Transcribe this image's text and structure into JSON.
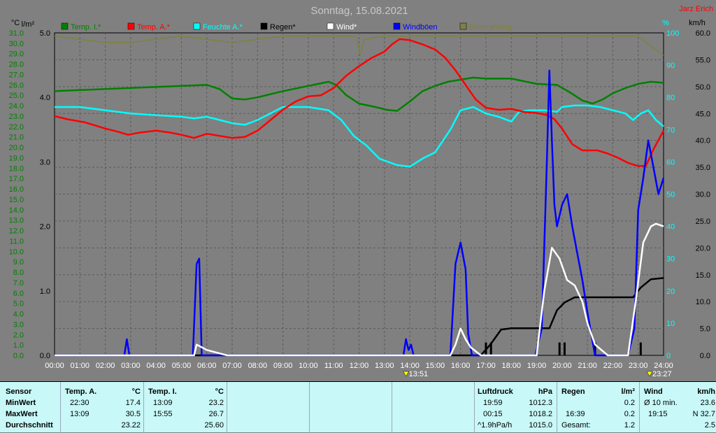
{
  "header": {
    "title": "Sonntag, 15.08.2021",
    "author": "Jarz Erich"
  },
  "colors": {
    "temp_i": "#008000",
    "temp_a": "#ff0000",
    "feuchte": "#00ffff",
    "regen": "#000000",
    "wind": "#ffffff",
    "windboeen": "#0000ff",
    "einstrahlung": "#808040"
  },
  "legend": [
    {
      "label": "Temp. I.*",
      "color": "#008000"
    },
    {
      "label": "Temp. A.*",
      "color": "#ff0000"
    },
    {
      "label": "Feuchte A.*",
      "color": "#00ffff"
    },
    {
      "label": "Regen*",
      "color": "#000000"
    },
    {
      "label": "Wind*",
      "color": "#ffffff"
    },
    {
      "label": "Windböen",
      "color": "#0000ff"
    },
    {
      "label": "Einstrahlung",
      "color": "#808040"
    }
  ],
  "axes": {
    "left_temp_unit": "°C",
    "left_rain_unit": "l/m²",
    "right_hum_unit": "%",
    "right_wind_unit": "km/h",
    "temp_ticks": [
      "31.0",
      "30.0",
      "29.0",
      "28.0",
      "27.0",
      "26.0",
      "25.0",
      "24.0",
      "23.0",
      "22.0",
      "21.0",
      "20.0",
      "19.0",
      "18.0",
      "17.0",
      "16.0",
      "15.0",
      "14.0",
      "13.0",
      "12.0",
      "11.0",
      "10.0",
      "9.0",
      "8.0",
      "7.0",
      "6.0",
      "5.0",
      "4.0",
      "3.0",
      "2.0",
      "1.0",
      "0.0"
    ],
    "rain_ticks": [
      "5.0",
      "4.0",
      "3.0",
      "2.0",
      "1.0",
      "0.0"
    ],
    "hum_ticks": [
      "100",
      "90",
      "80",
      "70",
      "60",
      "50",
      "40",
      "30",
      "20",
      "10",
      "0"
    ],
    "wind_ticks": [
      "60.0",
      "55.0",
      "50.0",
      "45.0",
      "40.0",
      "35.0",
      "30.0",
      "25.0",
      "20.0",
      "15.0",
      "10.0",
      "5.0",
      "0.0"
    ],
    "x_ticks": [
      "00:00",
      "01:00",
      "02:00",
      "03:00",
      "04:00",
      "05:00",
      "06:00",
      "07:00",
      "08:00",
      "09:00",
      "10:00",
      "11:00",
      "12:00",
      "13:00",
      "14:00",
      "15:00",
      "16:00",
      "17:00",
      "18:00",
      "19:00",
      "20:00",
      "21:00",
      "22:00",
      "23:00",
      "24:00"
    ],
    "markers": [
      {
        "time": 13.85,
        "label": "13:51"
      },
      {
        "time": 23.45,
        "label": "23:27"
      }
    ]
  },
  "chart_data": {
    "type": "line",
    "x_unit": "hours",
    "xlim": [
      0,
      24
    ],
    "series": [
      {
        "name": "Temp. I.*",
        "axis": "temp_c",
        "ylim": [
          0,
          31
        ],
        "points": [
          [
            0,
            25.4
          ],
          [
            1,
            25.5
          ],
          [
            2,
            25.6
          ],
          [
            3,
            25.7
          ],
          [
            4,
            25.8
          ],
          [
            5,
            25.9
          ],
          [
            6,
            26.0
          ],
          [
            6.5,
            25.6
          ],
          [
            7,
            24.7
          ],
          [
            7.5,
            24.6
          ],
          [
            8,
            24.8
          ],
          [
            8.5,
            25.1
          ],
          [
            9,
            25.4
          ],
          [
            10,
            25.9
          ],
          [
            10.8,
            26.3
          ],
          [
            11.1,
            26.0
          ],
          [
            11.5,
            25.0
          ],
          [
            12,
            24.2
          ],
          [
            12.6,
            23.9
          ],
          [
            13.1,
            23.6
          ],
          [
            13.5,
            23.5
          ],
          [
            14,
            24.4
          ],
          [
            14.5,
            25.4
          ],
          [
            15,
            25.9
          ],
          [
            15.5,
            26.3
          ],
          [
            16,
            26.5
          ],
          [
            16.5,
            26.7
          ],
          [
            17,
            26.6
          ],
          [
            18,
            26.6
          ],
          [
            19,
            26.1
          ],
          [
            19.8,
            26.0
          ],
          [
            20.3,
            25.3
          ],
          [
            20.8,
            24.5
          ],
          [
            21.2,
            24.2
          ],
          [
            21.6,
            24.6
          ],
          [
            22,
            25.2
          ],
          [
            22.5,
            25.7
          ],
          [
            23,
            26.1
          ],
          [
            23.5,
            26.3
          ],
          [
            24,
            26.2
          ]
        ]
      },
      {
        "name": "Temp. A.*",
        "axis": "temp_c",
        "ylim": [
          0,
          31
        ],
        "points": [
          [
            0,
            23.0
          ],
          [
            0.5,
            22.7
          ],
          [
            1.2,
            22.4
          ],
          [
            2,
            21.8
          ],
          [
            2.5,
            21.5
          ],
          [
            2.9,
            21.2
          ],
          [
            3.3,
            21.4
          ],
          [
            4,
            21.6
          ],
          [
            4.6,
            21.4
          ],
          [
            5,
            21.2
          ],
          [
            5.5,
            20.9
          ],
          [
            6,
            21.3
          ],
          [
            6.5,
            21.1
          ],
          [
            7,
            20.9
          ],
          [
            7.5,
            21.0
          ],
          [
            8,
            21.6
          ],
          [
            8.5,
            22.6
          ],
          [
            9,
            23.6
          ],
          [
            9.5,
            24.4
          ],
          [
            10,
            24.9
          ],
          [
            10.5,
            25.0
          ],
          [
            11,
            25.7
          ],
          [
            11.5,
            26.9
          ],
          [
            12,
            27.8
          ],
          [
            12.5,
            28.6
          ],
          [
            13,
            29.2
          ],
          [
            13.3,
            29.9
          ],
          [
            13.6,
            30.4
          ],
          [
            14,
            30.3
          ],
          [
            14.5,
            29.9
          ],
          [
            15,
            29.4
          ],
          [
            15.4,
            28.6
          ],
          [
            15.8,
            27.4
          ],
          [
            16.2,
            26.0
          ],
          [
            16.6,
            24.6
          ],
          [
            17,
            23.8
          ],
          [
            17.5,
            23.6
          ],
          [
            18,
            23.7
          ],
          [
            18.5,
            23.4
          ],
          [
            19,
            23.3
          ],
          [
            19.4,
            23.1
          ],
          [
            19.7,
            22.7
          ],
          [
            20,
            21.8
          ],
          [
            20.4,
            20.3
          ],
          [
            20.8,
            19.7
          ],
          [
            21.4,
            19.7
          ],
          [
            21.8,
            19.4
          ],
          [
            22.2,
            19.0
          ],
          [
            22.6,
            18.5
          ],
          [
            23,
            18.2
          ],
          [
            23.3,
            18.2
          ],
          [
            23.6,
            19.8
          ],
          [
            24,
            21.6
          ]
        ]
      },
      {
        "name": "Feuchte A.*",
        "axis": "humidity_pct",
        "ylim": [
          0,
          100
        ],
        "points": [
          [
            0,
            77
          ],
          [
            1,
            77
          ],
          [
            2,
            76
          ],
          [
            3,
            75
          ],
          [
            4,
            74.5
          ],
          [
            5,
            74
          ],
          [
            5.5,
            73.5
          ],
          [
            6,
            74
          ],
          [
            6.5,
            73
          ],
          [
            7,
            72
          ],
          [
            7.5,
            71.5
          ],
          [
            8,
            73
          ],
          [
            8.5,
            75
          ],
          [
            9,
            77
          ],
          [
            10,
            77
          ],
          [
            10.8,
            76
          ],
          [
            11.3,
            73
          ],
          [
            11.8,
            68
          ],
          [
            12.3,
            65
          ],
          [
            12.8,
            61
          ],
          [
            13.5,
            59
          ],
          [
            14,
            58.5
          ],
          [
            14.5,
            61
          ],
          [
            15,
            63
          ],
          [
            15.6,
            70
          ],
          [
            16,
            76
          ],
          [
            16.5,
            77
          ],
          [
            17,
            75
          ],
          [
            17.5,
            74
          ],
          [
            18,
            72.5
          ],
          [
            18.3,
            75.5
          ],
          [
            18.7,
            76
          ],
          [
            19.3,
            76
          ],
          [
            19.8,
            75.5
          ],
          [
            20,
            77
          ],
          [
            20.5,
            77.5
          ],
          [
            21,
            77.5
          ],
          [
            21.5,
            77
          ],
          [
            22,
            76
          ],
          [
            22.5,
            75
          ],
          [
            22.8,
            73
          ],
          [
            23.1,
            75
          ],
          [
            23.4,
            76
          ],
          [
            23.7,
            73
          ],
          [
            24,
            71
          ]
        ]
      },
      {
        "name": "Regen*",
        "axis": "rain_lm2",
        "ylim": [
          0,
          5
        ],
        "points": [
          [
            0,
            0
          ],
          [
            16.8,
            0
          ],
          [
            17.2,
            0.18
          ],
          [
            17.6,
            0.4
          ],
          [
            18,
            0.42
          ],
          [
            18.5,
            0.42
          ],
          [
            19,
            0.42
          ],
          [
            19.5,
            0.42
          ],
          [
            19.8,
            0.7
          ],
          [
            20.1,
            0.82
          ],
          [
            20.5,
            0.9
          ],
          [
            21,
            0.9
          ],
          [
            21.8,
            0.9
          ],
          [
            22.3,
            0.9
          ],
          [
            22.8,
            0.9
          ],
          [
            23.1,
            1.05
          ],
          [
            23.5,
            1.18
          ],
          [
            24,
            1.2
          ]
        ]
      },
      {
        "name": "Wind*",
        "axis": "wind_kmh",
        "ylim": [
          0,
          60
        ],
        "points": [
          [
            0,
            0
          ],
          [
            5.5,
            0
          ],
          [
            5.6,
            2
          ],
          [
            6,
            1
          ],
          [
            6.4,
            0.5
          ],
          [
            6.8,
            0
          ],
          [
            15.6,
            0
          ],
          [
            15.8,
            2
          ],
          [
            16,
            5
          ],
          [
            16.2,
            3
          ],
          [
            16.4,
            1.5
          ],
          [
            16.8,
            0
          ],
          [
            19,
            0
          ],
          [
            19.3,
            12
          ],
          [
            19.6,
            20
          ],
          [
            19.9,
            18
          ],
          [
            20.2,
            14
          ],
          [
            20.5,
            13
          ],
          [
            20.8,
            10
          ],
          [
            21,
            6
          ],
          [
            21.3,
            2
          ],
          [
            21.8,
            0
          ],
          [
            22.6,
            0
          ],
          [
            22.9,
            10
          ],
          [
            23.2,
            21
          ],
          [
            23.5,
            24
          ],
          [
            23.7,
            24.5
          ],
          [
            24,
            24
          ]
        ]
      },
      {
        "name": "Windböen",
        "axis": "wind_kmh",
        "ylim": [
          0,
          60
        ],
        "points": [
          [
            0,
            0
          ],
          [
            2.75,
            0
          ],
          [
            2.85,
            3
          ],
          [
            2.95,
            0
          ],
          [
            5.45,
            0
          ],
          [
            5.6,
            17
          ],
          [
            5.7,
            18
          ],
          [
            5.8,
            0
          ],
          [
            13.75,
            0
          ],
          [
            13.85,
            3
          ],
          [
            13.95,
            1
          ],
          [
            14.05,
            2
          ],
          [
            14.15,
            0
          ],
          [
            15.6,
            0
          ],
          [
            15.8,
            17
          ],
          [
            16,
            21
          ],
          [
            16.2,
            16
          ],
          [
            16.3,
            4
          ],
          [
            16.45,
            0
          ],
          [
            18.95,
            0
          ],
          [
            19.2,
            5
          ],
          [
            19.4,
            36
          ],
          [
            19.5,
            53
          ],
          [
            19.6,
            40
          ],
          [
            19.7,
            28
          ],
          [
            19.8,
            24
          ],
          [
            20,
            28
          ],
          [
            20.2,
            30
          ],
          [
            20.4,
            24
          ],
          [
            20.6,
            19
          ],
          [
            20.8,
            14
          ],
          [
            21,
            8
          ],
          [
            21.3,
            0
          ],
          [
            22.6,
            0
          ],
          [
            22.85,
            5
          ],
          [
            23.0,
            27
          ],
          [
            23.2,
            33
          ],
          [
            23.4,
            40
          ],
          [
            23.6,
            35
          ],
          [
            23.8,
            30
          ],
          [
            24,
            33
          ]
        ]
      },
      {
        "name": "Einstrahlung",
        "axis": "radiation",
        "ylim": [
          0,
          100
        ],
        "points": [
          [
            0,
            99
          ],
          [
            1,
            98
          ],
          [
            2,
            97
          ],
          [
            3,
            97
          ],
          [
            4,
            98
          ],
          [
            5,
            99
          ],
          [
            6,
            98
          ],
          [
            7,
            97
          ],
          [
            8,
            98
          ],
          [
            9,
            99
          ],
          [
            10,
            99
          ],
          [
            11,
            99
          ],
          [
            11.9,
            99
          ],
          [
            12.05,
            93
          ],
          [
            12.2,
            98
          ],
          [
            13,
            99
          ],
          [
            14,
            99
          ],
          [
            15,
            99
          ],
          [
            16,
            99
          ],
          [
            17,
            99
          ],
          [
            18,
            99
          ],
          [
            19,
            99
          ],
          [
            20,
            99
          ],
          [
            21,
            99
          ],
          [
            22,
            99
          ],
          [
            23,
            99
          ],
          [
            24,
            93
          ]
        ]
      }
    ],
    "rain_bars": [
      17.0,
      17.2,
      19.9,
      20.1,
      21.3,
      23.1
    ]
  },
  "table": {
    "sensor_label": "Sensor",
    "rows": [
      "MinWert",
      "MaxWert",
      "Durchschnitt"
    ],
    "temp_a": {
      "title": "Temp. A.",
      "unit": "°C",
      "min_time": "22:30",
      "min": "17.4",
      "max_time": "13:09",
      "max": "30.5",
      "avg": "23.22"
    },
    "temp_i": {
      "title": "Temp. I.",
      "unit": "°C",
      "min_time": "13:09",
      "min": "23.2",
      "max_time": "15:55",
      "max": "26.7",
      "avg": "25.60"
    },
    "luftdruck": {
      "title": "Luftdruck",
      "unit": "hPa",
      "min_time": "19:59",
      "min": "1012.3",
      "max_time": "00:15",
      "max": "1018.2",
      "trend": "^1.9hPa/h",
      "avg": "1015.0"
    },
    "regen": {
      "title": "Regen",
      "unit": "l/m²",
      "min": "0.2",
      "max_time": "16:39",
      "max": "0.2",
      "total_label": "Gesamt:",
      "total": "1.2"
    },
    "wind": {
      "title": "Wind",
      "unit": "km/h",
      "r1_label": "Ø 10 min.",
      "r1_val": "23.6",
      "r2_time": "19:15",
      "r2_val": "N 32.7",
      "r3_val": "2.5"
    }
  }
}
